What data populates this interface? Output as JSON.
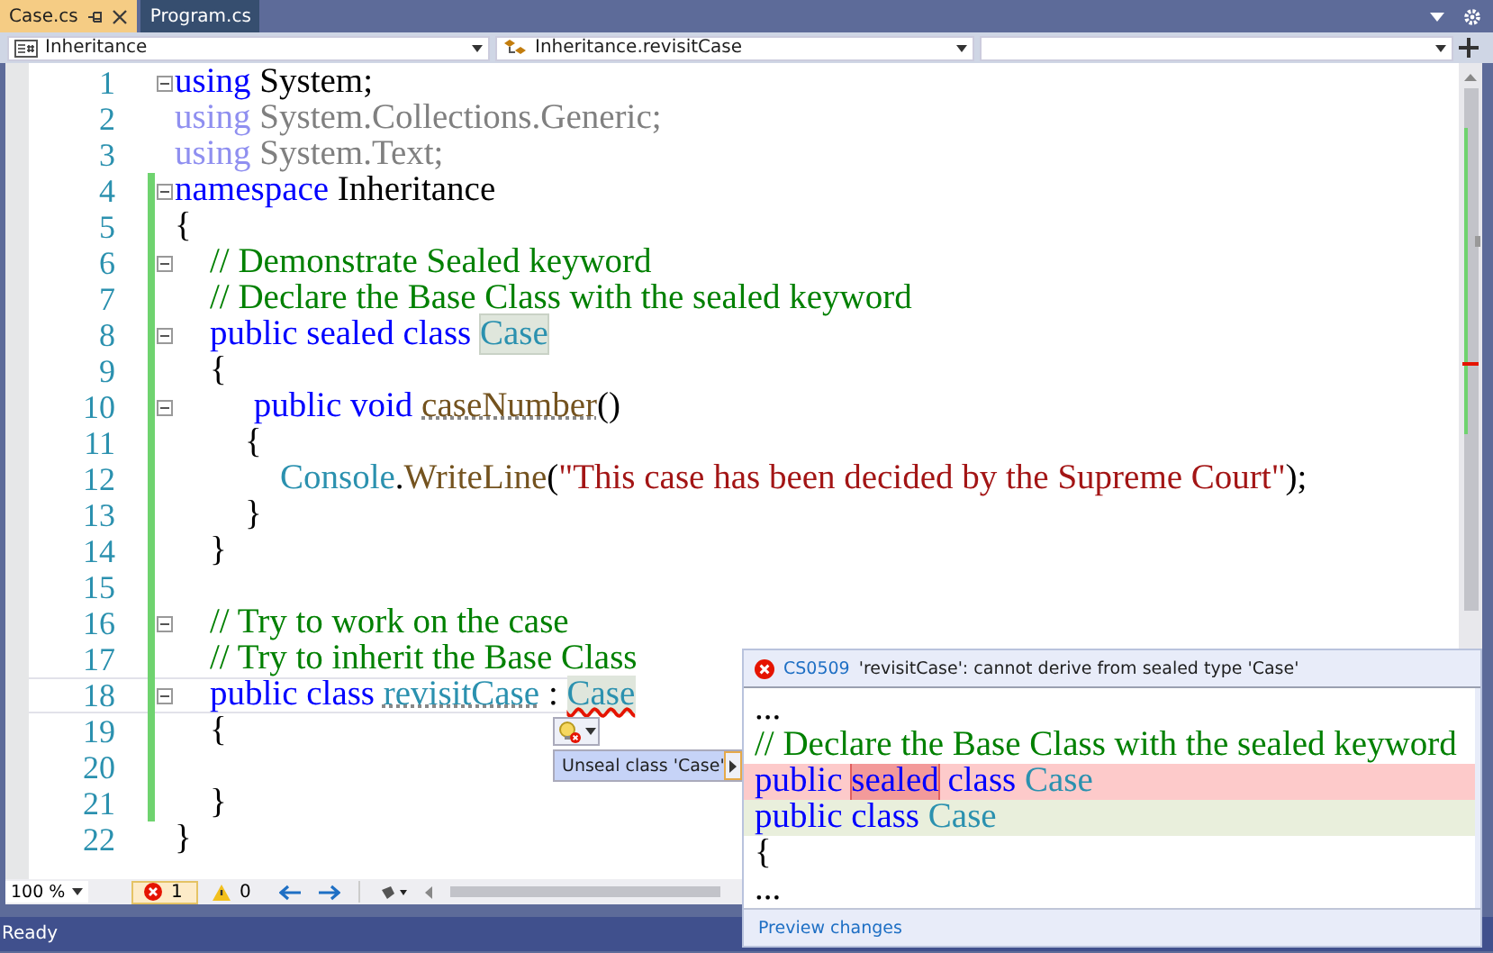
{
  "tabs": [
    {
      "label": "Case.cs",
      "selected": true,
      "pinned": true
    },
    {
      "label": "Program.cs",
      "selected": false,
      "pinned": false
    }
  ],
  "navigation": {
    "project": "Inheritance",
    "member": "Inheritance.revisitCase"
  },
  "lines": [
    {
      "number": "1",
      "fold": true,
      "modified": false,
      "current": false,
      "tokens": [
        {
          "kind": "kw",
          "text": "using"
        },
        {
          "kind": "plain",
          "text": " System;"
        }
      ]
    },
    {
      "number": "2",
      "fold": false,
      "modified": false,
      "current": false,
      "tokens": [
        {
          "kind": "kw-faded",
          "text": "using"
        },
        {
          "kind": "plain-faded",
          "text": " System.Collections.Generic;"
        }
      ]
    },
    {
      "number": "3",
      "fold": false,
      "modified": false,
      "current": false,
      "tokens": [
        {
          "kind": "kw-faded",
          "text": "using"
        },
        {
          "kind": "plain-faded",
          "text": " System.Text;"
        }
      ]
    },
    {
      "number": "4",
      "fold": true,
      "modified": true,
      "current": false,
      "tokens": [
        {
          "kind": "kw",
          "text": "namespace"
        },
        {
          "kind": "plain",
          "text": " Inheritance"
        }
      ]
    },
    {
      "number": "5",
      "fold": false,
      "modified": true,
      "current": false,
      "tokens": [
        {
          "kind": "plain",
          "text": "{"
        }
      ]
    },
    {
      "number": "6",
      "fold": true,
      "modified": true,
      "current": false,
      "tokens": [
        {
          "kind": "comment",
          "text": "    // Demonstrate Sealed keyword"
        }
      ]
    },
    {
      "number": "7",
      "fold": false,
      "modified": true,
      "current": false,
      "tokens": [
        {
          "kind": "comment",
          "text": "    // Declare the Base Class with the sealed keyword"
        }
      ]
    },
    {
      "number": "8",
      "fold": true,
      "modified": true,
      "current": false,
      "tokens": [
        {
          "kind": "kw",
          "text": "    public sealed class "
        },
        {
          "kind": "type-highlighted",
          "text": "Case"
        }
      ]
    },
    {
      "number": "9",
      "fold": false,
      "modified": true,
      "current": false,
      "tokens": [
        {
          "kind": "plain",
          "text": "    {"
        }
      ]
    },
    {
      "number": "10",
      "fold": true,
      "modified": true,
      "current": false,
      "tokens": [
        {
          "kind": "kw",
          "text": "         public void "
        },
        {
          "kind": "method-underlined",
          "text": "caseNumber"
        },
        {
          "kind": "plain",
          "text": "()"
        }
      ]
    },
    {
      "number": "11",
      "fold": false,
      "modified": true,
      "current": false,
      "tokens": [
        {
          "kind": "plain",
          "text": "        {"
        }
      ]
    },
    {
      "number": "12",
      "fold": false,
      "modified": true,
      "current": false,
      "tokens": [
        {
          "kind": "type",
          "text": "            Console"
        },
        {
          "kind": "plain",
          "text": "."
        },
        {
          "kind": "method",
          "text": "WriteLine"
        },
        {
          "kind": "plain",
          "text": "("
        },
        {
          "kind": "string",
          "text": "\"This case has been decided by the Supreme Court\""
        },
        {
          "kind": "plain",
          "text": ");"
        }
      ]
    },
    {
      "number": "13",
      "fold": false,
      "modified": true,
      "current": false,
      "tokens": [
        {
          "kind": "plain",
          "text": "        }"
        }
      ]
    },
    {
      "number": "14",
      "fold": false,
      "modified": true,
      "current": false,
      "tokens": [
        {
          "kind": "plain",
          "text": "    }"
        }
      ]
    },
    {
      "number": "15",
      "fold": false,
      "modified": true,
      "current": false
    },
    {
      "number": "16",
      "fold": true,
      "modified": true,
      "current": false,
      "tokens": [
        {
          "kind": "comment",
          "text": "    // Try to work on the case"
        }
      ]
    },
    {
      "number": "17",
      "fold": false,
      "modified": true,
      "current": false,
      "tokens": [
        {
          "kind": "comment",
          "text": "    // Try to inherit the Base Class"
        }
      ]
    },
    {
      "number": "18",
      "fold": true,
      "modified": true,
      "current": true,
      "tokens": [
        {
          "kind": "kw",
          "text": "    public class "
        },
        {
          "kind": "type-underlined",
          "text": "revisitCase"
        },
        {
          "kind": "plain",
          "text": " : "
        },
        {
          "kind": "type-error",
          "text": "Case"
        }
      ]
    },
    {
      "number": "19",
      "fold": false,
      "modified": true,
      "current": false,
      "tokens": [
        {
          "kind": "plain",
          "text": "    {"
        }
      ]
    },
    {
      "number": "20",
      "fold": false,
      "modified": true,
      "current": false
    },
    {
      "number": "21",
      "fold": false,
      "modified": true,
      "current": false,
      "tokens": [
        {
          "kind": "plain",
          "text": "    }"
        }
      ]
    },
    {
      "number": "22",
      "fold": false,
      "modified": false,
      "current": false,
      "tokens": [
        {
          "kind": "plain",
          "text": "}"
        }
      ]
    }
  ],
  "quick_actions": {
    "menu_item": "Unseal class 'Case'"
  },
  "preview": {
    "code": "CS0509",
    "message": "'revisitCase': cannot derive from sealed type 'Case'",
    "lines": [
      {
        "kind": "context",
        "tokens": [
          {
            "kind": "plain",
            "text": "..."
          }
        ]
      },
      {
        "kind": "context",
        "tokens": [
          {
            "kind": "comment",
            "text": "// Declare the Base Class with the sealed keyword"
          }
        ]
      },
      {
        "kind": "removed",
        "tokens": [
          {
            "kind": "kw",
            "text": "public "
          },
          {
            "kind": "kw-removed",
            "text": "sealed"
          },
          {
            "kind": "kw",
            "text": " class "
          },
          {
            "kind": "type",
            "text": "Case"
          }
        ]
      },
      {
        "kind": "added",
        "tokens": [
          {
            "kind": "kw",
            "text": "public class "
          },
          {
            "kind": "type",
            "text": "Case"
          }
        ]
      },
      {
        "kind": "context",
        "tokens": [
          {
            "kind": "plain",
            "text": "{"
          }
        ]
      },
      {
        "kind": "context",
        "tokens": [
          {
            "kind": "plain",
            "text": "..."
          }
        ]
      }
    ],
    "footer_link": "Preview changes"
  },
  "editor_bar": {
    "zoom": "100 %",
    "errors": "1",
    "warnings": "0"
  },
  "status_bar": {
    "text": "Ready"
  }
}
